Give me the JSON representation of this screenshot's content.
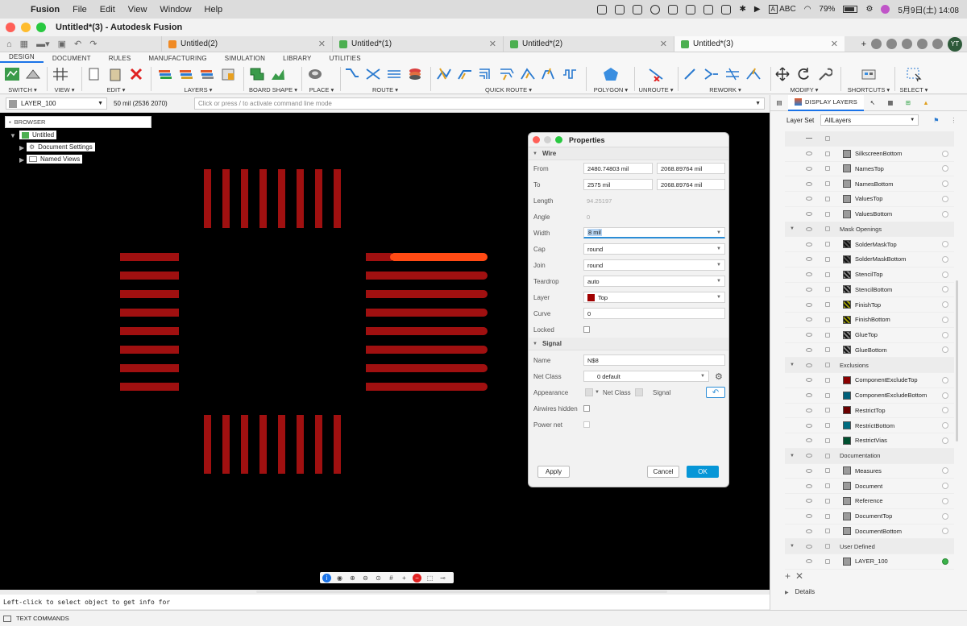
{
  "menubar": {
    "app": "Fusion",
    "items": [
      "File",
      "Edit",
      "View",
      "Window",
      "Help"
    ],
    "battery": "79%",
    "input": "ABC",
    "input_badge": "A",
    "datetime": "5月9日(土) 14:08"
  },
  "window": {
    "title": "Untitled*(3) - Autodesk Fusion"
  },
  "doc_tabs": [
    {
      "label": "Untitled(2)",
      "color": "#f08a24"
    },
    {
      "label": "Untitled*(1)",
      "color": "#4caf50"
    },
    {
      "label": "Untitled*(2)",
      "color": "#4caf50"
    },
    {
      "label": "Untitled*(3)",
      "color": "#4caf50",
      "active": true
    }
  ],
  "user": {
    "initials": "YT"
  },
  "ribbon_tabs": [
    "DESIGN",
    "DOCUMENT",
    "RULES",
    "MANUFACTURING",
    "SIMULATION",
    "LIBRARY",
    "UTILITIES"
  ],
  "ribbon_groups": {
    "switch": "SWITCH ▾",
    "view": "VIEW ▾",
    "edit": "EDIT ▾",
    "layers": "LAYERS ▾",
    "board_shape": "BOARD SHAPE ▾",
    "place": "PLACE ▾",
    "route": "ROUTE ▾",
    "quick_route": "QUICK ROUTE ▾",
    "polygon": "POLYGON ▾",
    "unroute": "UNROUTE ▾",
    "rework": "REWORK ▾",
    "modify": "MODIFY ▾",
    "shortcuts": "SHORTCUTS ▾",
    "select": "SELECT ▾"
  },
  "cmdbar": {
    "layer": "LAYER_100",
    "grid": "50 mil (2536 2070)",
    "placeholder": "Click or press / to activate command line mode"
  },
  "browser": {
    "header": "BROWSER",
    "root": "Untitled",
    "items": [
      "Document Settings",
      "Named Views"
    ]
  },
  "properties": {
    "title": "Properties",
    "wire_section": "Wire",
    "from_label": "From",
    "from_x": "2480.74803 mil",
    "from_y": "2068.89764 mil",
    "to_label": "To",
    "to_x": "2575 mil",
    "to_y": "2068.89764 mil",
    "length_label": "Length",
    "length": "94.25197",
    "angle_label": "Angle",
    "angle": "0",
    "width_label": "Width",
    "width": "8 mil",
    "cap_label": "Cap",
    "cap": "round",
    "join_label": "Join",
    "join": "round",
    "teardrop_label": "Teardrop",
    "teardrop": "auto",
    "layer_label": "Layer",
    "layer": "Top",
    "layer_color": "#a00000",
    "curve_label": "Curve",
    "curve": "0",
    "locked_label": "Locked",
    "signal_section": "Signal",
    "name_label": "Name",
    "name": "N$8",
    "netclass_label": "Net Class",
    "netclass": "0 default",
    "appearance_label": "Appearance",
    "appearance_netclass": "Net Class",
    "appearance_signal": "Signal",
    "airwires_label": "Airwires hidden",
    "powernet_label": "Power net",
    "apply": "Apply",
    "cancel": "Cancel",
    "ok": "OK"
  },
  "display_layers": {
    "tab_label": "DISPLAY LAYERS",
    "layerset_label": "Layer Set",
    "layerset_value": "AllLayers",
    "rows": [
      {
        "type": "top"
      },
      {
        "type": "layer",
        "name": "SilkscreenBottom",
        "color": "#9b9b9b"
      },
      {
        "type": "layer",
        "name": "NamesTop",
        "color": "#9b9b9b"
      },
      {
        "type": "layer",
        "name": "NamesBottom",
        "color": "#9b9b9b"
      },
      {
        "type": "layer",
        "name": "ValuesTop",
        "color": "#9b9b9b"
      },
      {
        "type": "layer",
        "name": "ValuesBottom",
        "color": "#9b9b9b"
      },
      {
        "type": "group",
        "name": "Mask Openings"
      },
      {
        "type": "layer",
        "name": "SolderMaskTop",
        "color": "#555555",
        "hatch": true
      },
      {
        "type": "layer",
        "name": "SolderMaskBottom",
        "color": "#555555",
        "hatch": true
      },
      {
        "type": "layer",
        "name": "StencilTop",
        "color": "#888888",
        "hatch": true
      },
      {
        "type": "layer",
        "name": "StencilBottom",
        "color": "#888888",
        "hatch": true
      },
      {
        "type": "layer",
        "name": "FinishTop",
        "color": "#a0a000",
        "hatch": true
      },
      {
        "type": "layer",
        "name": "FinishBottom",
        "color": "#a0a000",
        "hatch": true
      },
      {
        "type": "layer",
        "name": "GlueTop",
        "color": "#888888",
        "hatch": true
      },
      {
        "type": "layer",
        "name": "GlueBottom",
        "color": "#888888",
        "hatch": true
      },
      {
        "type": "group",
        "name": "Exclusions"
      },
      {
        "type": "layer",
        "name": "ComponentExcludeTop",
        "color": "#8a0000"
      },
      {
        "type": "layer",
        "name": "ComponentExcludeBottom",
        "color": "#00607a"
      },
      {
        "type": "layer",
        "name": "RestrictTop",
        "color": "#6a0000"
      },
      {
        "type": "layer",
        "name": "RestrictBottom",
        "color": "#006c80"
      },
      {
        "type": "layer",
        "name": "RestrictVias",
        "color": "#005030"
      },
      {
        "type": "group",
        "name": "Documentation"
      },
      {
        "type": "layer",
        "name": "Measures",
        "color": "#9b9b9b"
      },
      {
        "type": "layer",
        "name": "Document",
        "color": "#9b9b9b"
      },
      {
        "type": "layer",
        "name": "Reference",
        "color": "#9b9b9b"
      },
      {
        "type": "layer",
        "name": "DocumentTop",
        "color": "#9b9b9b"
      },
      {
        "type": "layer",
        "name": "DocumentBottom",
        "color": "#9b9b9b"
      },
      {
        "type": "group",
        "name": "User Defined"
      },
      {
        "type": "layer",
        "name": "LAYER_100",
        "color": "#9b9b9b",
        "active": true
      }
    ],
    "details": "Details"
  },
  "status": {
    "message": "Left-click to select object to get info for"
  },
  "text_commands": "TEXT COMMANDS",
  "colors": {
    "pad": "#a01010",
    "selected_wire": "#ff4a14",
    "accent": "#0696d7"
  }
}
